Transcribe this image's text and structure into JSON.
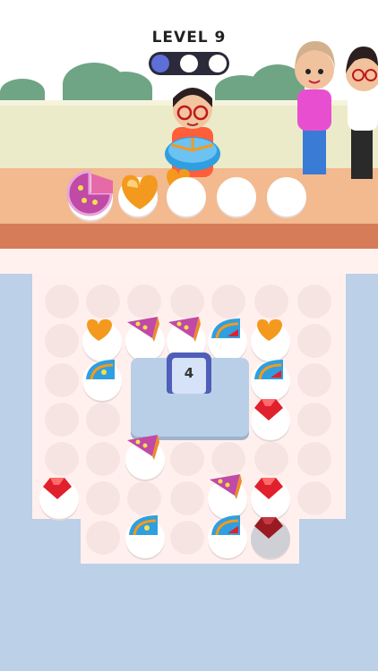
{
  "level": {
    "label": "LEVEL 9",
    "progress_total": 3,
    "progress_done": 1
  },
  "box": {
    "count": "4"
  },
  "colors": {
    "pie_purple": "#c04aa6",
    "fan_blue": "#2f9fe0",
    "heart_orange": "#f39a1e",
    "gem_red": "#e0202c",
    "progress_active": "#5e6fd8"
  },
  "icons": {
    "pie": "pie-slice-icon",
    "fan": "fan-cake-icon",
    "heart": "heart-cookie-icon",
    "gem": "red-gem-candy-icon"
  }
}
